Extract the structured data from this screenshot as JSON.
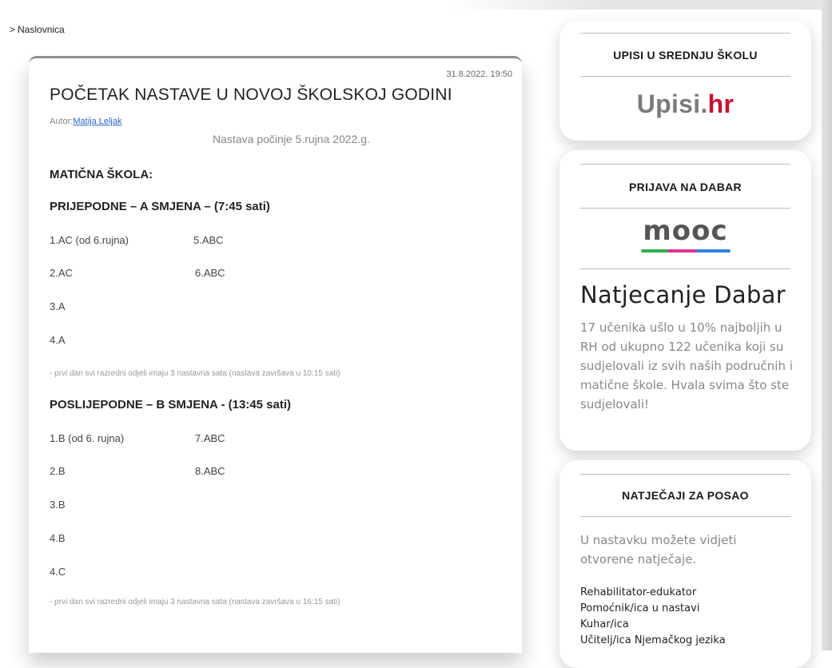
{
  "breadcrumb": {
    "separator": ">",
    "home": "Naslovnica"
  },
  "article": {
    "date": "31.8.2022. 19:50",
    "title": "POČETAK NASTAVE U NOVOJ ŠKOLSKOJ GODINI",
    "author_label": "Autor:",
    "author_name": "Matija Leljak",
    "subtitle": "Nastava počinje 5.rujna 2022.g.",
    "school_heading": "MATIČNA ŠKOLA:",
    "shift_a": {
      "heading": "PRIJEPODNE – A SMJENA – (7:45 sati)",
      "rows": [
        {
          "col1": "1.AC (od 6.rujna)",
          "col2": "5.ABC"
        },
        {
          "col1": "2.AC",
          "col2": "6.ABC"
        },
        {
          "col1": "3.A",
          "col2": ""
        },
        {
          "col1": "4.A",
          "col2": ""
        }
      ],
      "note": "- prvi dan svi razredni odjeli imaju 3 nastavna sata (nastava završava u 10:15 sati)"
    },
    "shift_b": {
      "heading": "POSLIJEPODNE – B SMJENA - (13:45 sati)",
      "rows": [
        {
          "col1": "1.B (od 6. rujna)",
          "col2": "7.ABC"
        },
        {
          "col1": "2.B",
          "col2": "8.ABC"
        },
        {
          "col1": "3.B",
          "col2": ""
        },
        {
          "col1": "4.B",
          "col2": ""
        },
        {
          "col1": "4.C",
          "col2": ""
        }
      ],
      "note": "- prvi dan svi razredni odjeli imaju 3 nastavna sata (nastava završava u  16:15 sati)"
    }
  },
  "sidebar": {
    "upisi": {
      "title": "UPISI U SREDNJU ŠKOLU",
      "logo_main": "Upisi.",
      "logo_accent": "hr"
    },
    "dabar": {
      "title": "PRIJAVA NA DABAR",
      "logo": "mooc",
      "heading": "Natjecanje Dabar",
      "text": "17 učenika ušlo u 10% najboljih u RH od ukupno 122 učenika koji su sudjelovali iz svih naših područnih i matične škole. Hvala svima što ste sudjelovali!"
    },
    "jobs": {
      "title": "NATJEČAJI ZA POSAO",
      "intro": "U nastavku možete vidjeti otvorene natječaje.",
      "items": [
        "Rehabilitator-edukator",
        "Pomoćnik/ica u nastavi",
        "Kuhar/ica",
        "Učitelj/ica Njemačkog jezika"
      ]
    }
  },
  "colors": {
    "link": "#2a64c8",
    "accent_red": "#c8102e",
    "muted_text": "#888888"
  }
}
